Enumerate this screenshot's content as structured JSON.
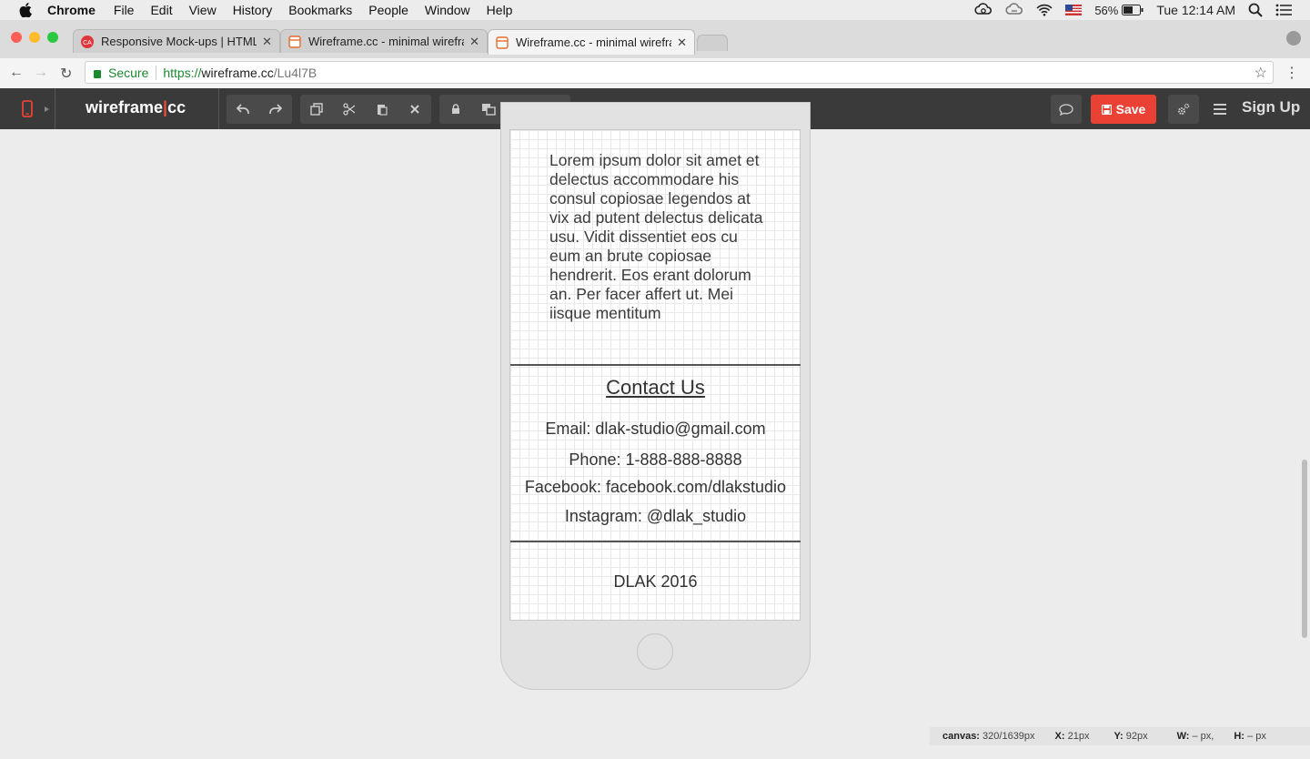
{
  "menubar": {
    "app": "Chrome",
    "items": [
      "File",
      "Edit",
      "View",
      "History",
      "Bookmarks",
      "People",
      "Window",
      "Help"
    ],
    "battery": "56%",
    "clock": "Tue 12:14 AM"
  },
  "tabs": [
    {
      "title": "Responsive Mock-ups | HTML,",
      "active": false
    },
    {
      "title": "Wireframe.cc - minimal wirefra",
      "active": false
    },
    {
      "title": "Wireframe.cc - minimal wirefra",
      "active": true
    }
  ],
  "address": {
    "secure_label": "Secure",
    "scheme": "https://",
    "host": "wireframe.cc",
    "path": "/Lu4l7B"
  },
  "app": {
    "logo_left": "wireframe",
    "logo_sep": "|",
    "logo_right": "cc",
    "save_label": "Save",
    "signup_label": "Sign Up"
  },
  "wireframe": {
    "lorem": "Lorem ipsum dolor sit amet et delectus accommodare his consul copiosae legendos at vix ad putent delectus delicata usu. Vidit dissentiet eos cu eum an brute copiosae hendrerit. Eos erant dolorum an. Per facer affert ut. Mei iisque mentitum",
    "contact_title": "Contact Us",
    "email": "Email: dlak-studio@gmail.com",
    "phone": "Phone: 1-888-888-8888",
    "facebook": "Facebook: facebook.com/dlakstudio",
    "instagram": "Instagram: @dlak_studio",
    "footer": "DLAK 2016"
  },
  "status": {
    "canvas_label": "canvas:",
    "canvas_value": "320/1639px",
    "x_label": "X:",
    "x_value": "21px",
    "y_label": "Y:",
    "y_value": "92px",
    "w_label": "W:",
    "w_value": "– px,",
    "h_label": "H:",
    "h_value": "– px"
  },
  "colors": {
    "save": "#e94235",
    "appbar": "#3a3a3a",
    "logo_accent": "#e94f37",
    "secure": "#1a8a2e"
  }
}
